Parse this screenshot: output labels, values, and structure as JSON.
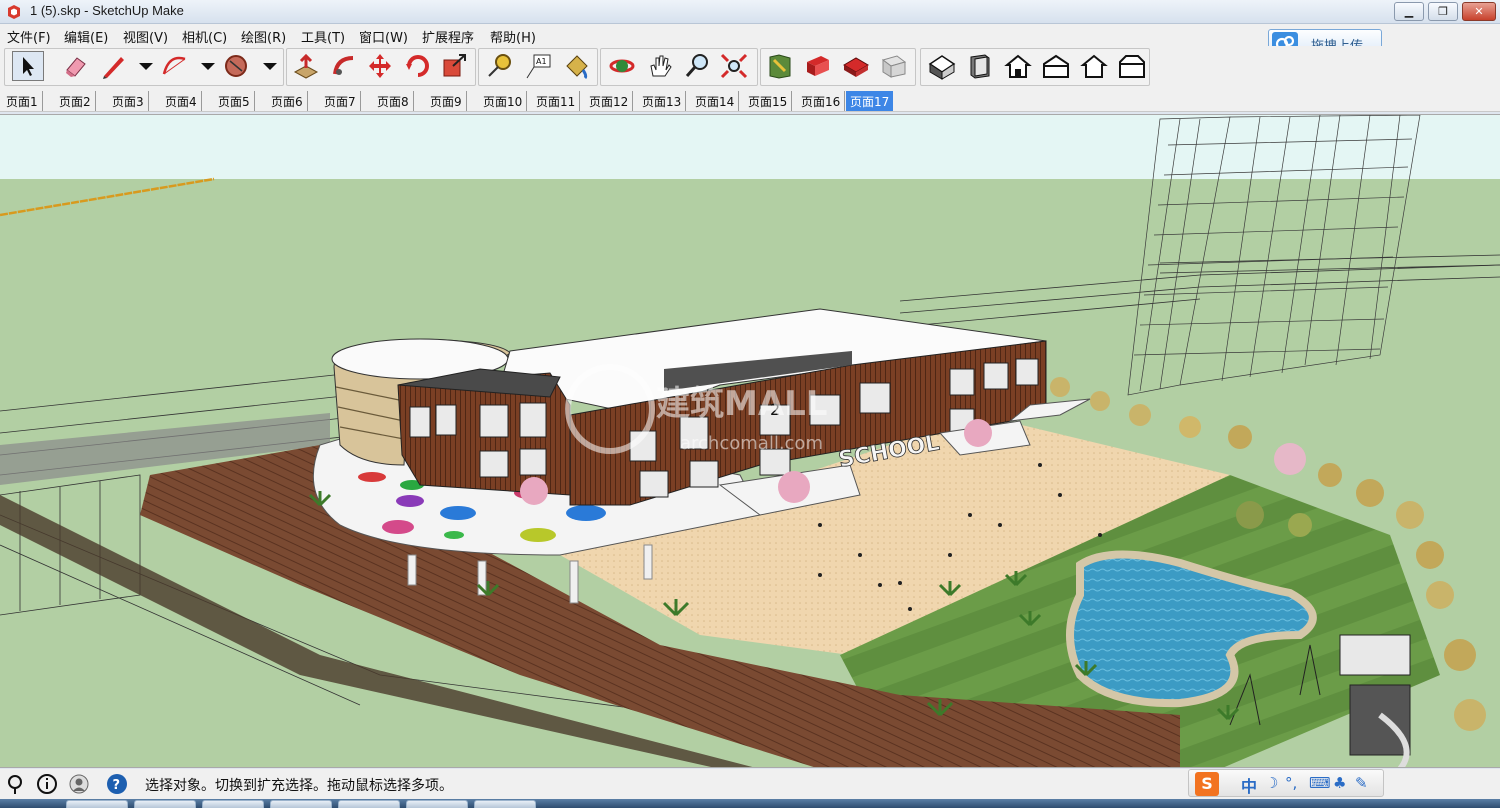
{
  "window": {
    "title": "1 (5).skp - SketchUp Make",
    "minimize": "▁",
    "maximize": "❐",
    "close": "✕"
  },
  "menu": [
    "文件(F)",
    "编辑(E)",
    "视图(V)",
    "相机(C)",
    "绘图(R)",
    "工具(T)",
    "窗口(W)",
    "扩展程序",
    "帮助(H)"
  ],
  "upload_button": {
    "label": "拖拽上传"
  },
  "toolbar": {
    "tools": [
      "select-tool",
      "eraser-tool",
      "line-tool",
      "arc-tool",
      "shapes-tool",
      "push-pull-tool",
      "follow-me-tool",
      "move-tool",
      "rotate-tool",
      "scale-tool",
      "tape-measure-tool",
      "text-tool",
      "paint-bucket-tool",
      "orbit-tool",
      "pan-tool",
      "zoom-tool",
      "zoom-extents-tool",
      "get-models-tool",
      "share-model-tool",
      "3d-warehouse-tool",
      "extension-warehouse-tool",
      "iso-view",
      "top-view",
      "front-view",
      "right-view",
      "back-view",
      "left-view"
    ]
  },
  "pages": {
    "tabs": [
      "页面1",
      "页面2",
      "页面3",
      "页面4",
      "页面5",
      "页面6",
      "页面7",
      "页面8",
      "页面9",
      "页面10",
      "页面11",
      "页面12",
      "页面13",
      "页面14",
      "页面15",
      "页面16",
      "页面17"
    ],
    "active": "页面17"
  },
  "scene": {
    "sky_color": "#e4f6f4",
    "ground_color": "#b2cfa3",
    "building_sign": "SCHOOL",
    "watermark_text": "建筑MALL",
    "watermark_sub": "archcomall.com",
    "level_label": "2"
  },
  "status": {
    "message": "选择对象。切换到扩充选择。拖动鼠标选择多项。"
  },
  "ime": {
    "logo": "S",
    "mode": "中",
    "glyphs": [
      "☽",
      "°,",
      "⌨",
      "♣",
      "✎"
    ]
  }
}
